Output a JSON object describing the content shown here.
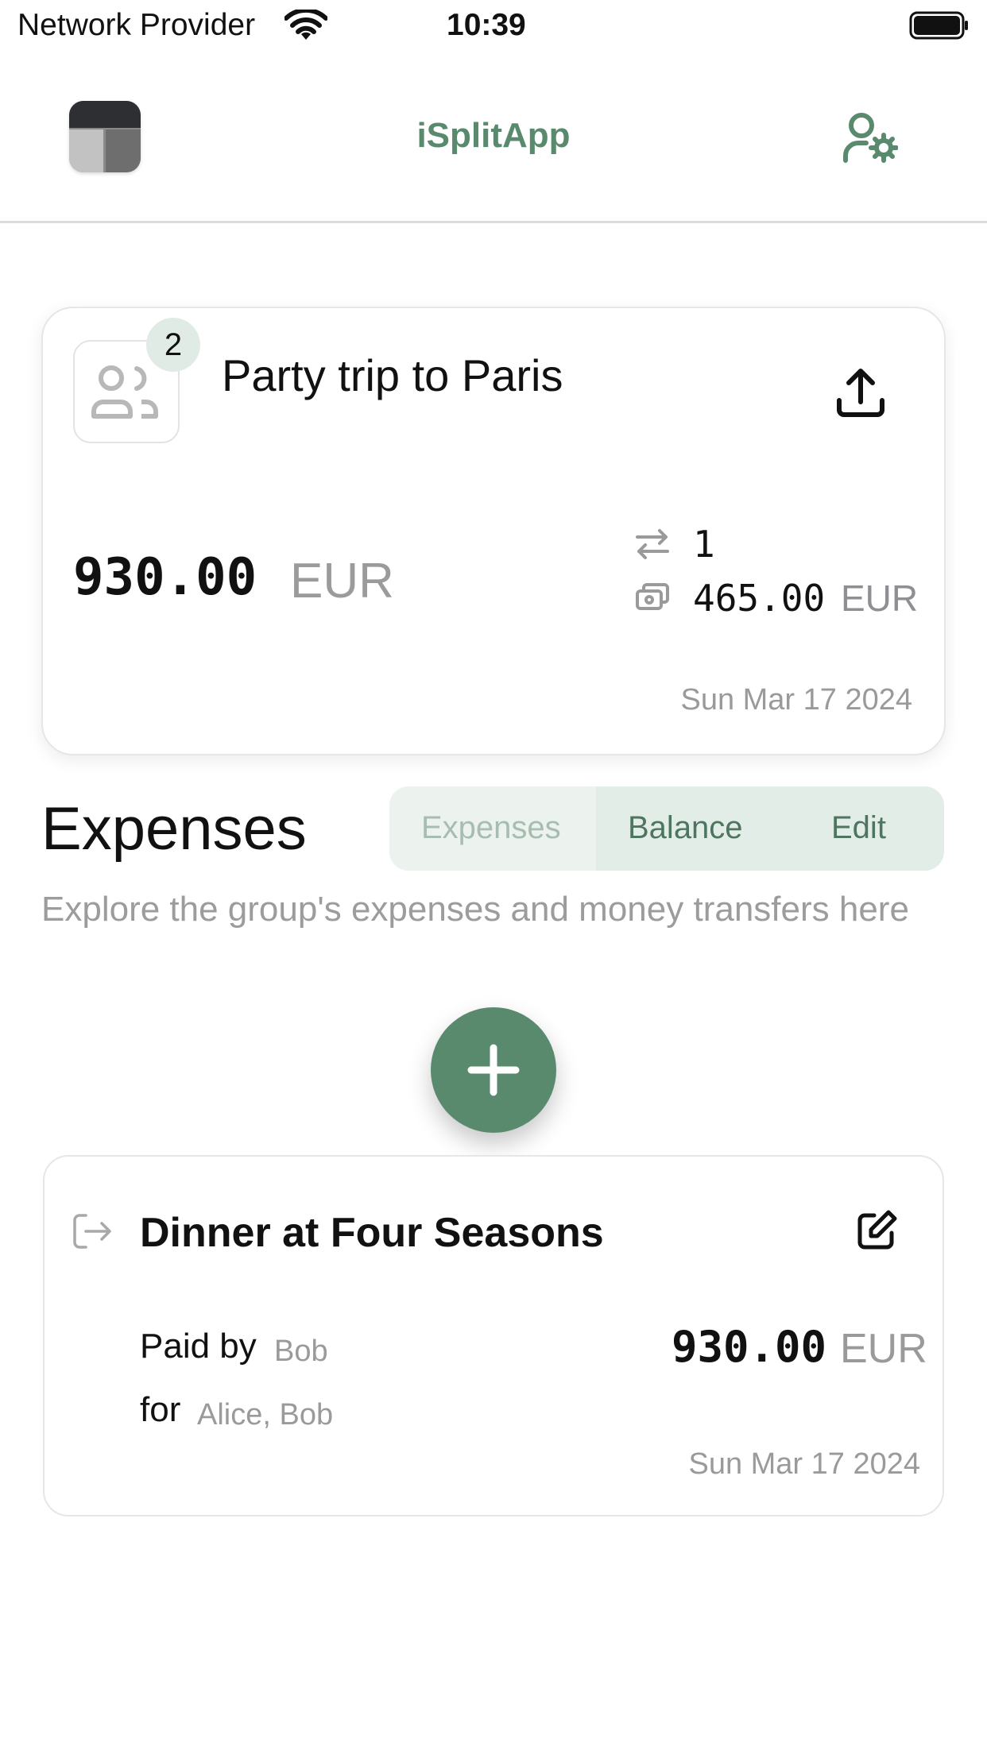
{
  "status_bar": {
    "carrier": "Network Provider",
    "time": "10:39"
  },
  "header": {
    "title": "iSplitApp"
  },
  "group": {
    "name": "Party trip to Paris",
    "member_count": "2",
    "total_amount": "930.00",
    "total_currency": "EUR",
    "transfers_count": "1",
    "per_person_amount": "465.00",
    "per_person_currency": "EUR",
    "date": "Sun Mar 17 2024"
  },
  "expenses_section": {
    "title": "Expenses",
    "tabs": [
      {
        "label": "Expenses",
        "selected": true
      },
      {
        "label": "Balance",
        "selected": false
      },
      {
        "label": "Edit",
        "selected": false
      }
    ],
    "description": "Explore the group's expenses and money transfers here"
  },
  "expenses": [
    {
      "title": "Dinner at Four Seasons",
      "paid_by_label": "Paid by",
      "paid_by": "Bob",
      "for_label": "for",
      "for_names": "Alice, Bob",
      "amount": "930.00",
      "currency": "EUR",
      "date": "Sun Mar 17 2024"
    }
  ],
  "icons": {
    "wifi": "wifi-icon",
    "battery": "battery-icon",
    "logo": "app-logo-icon",
    "settings": "user-settings-icon",
    "group": "users-icon",
    "share": "share-icon",
    "transfer": "arrows-exchange-icon",
    "cash": "cash-icon",
    "add": "plus-icon",
    "expense_type": "logout-arrow-icon",
    "edit": "edit-icon"
  },
  "colors": {
    "accent": "#5a8a6e",
    "segment_bg": "#e3ede7",
    "muted_text": "#9a9a9a"
  }
}
